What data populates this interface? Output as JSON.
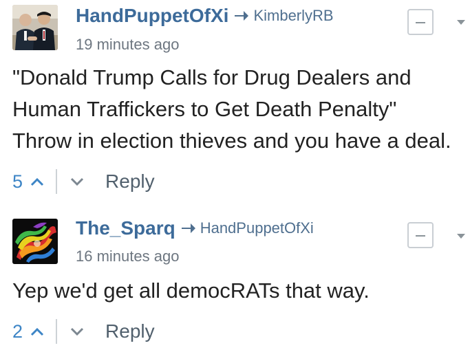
{
  "comments": [
    {
      "author": "HandPuppetOfXi",
      "reply_to": "KimberlyRB",
      "timestamp": "19 minutes ago",
      "body_lines": [
        "\"Donald Trump Calls for Drug Dealers and",
        "Human Traffickers to Get Death Penalty\"",
        "Throw in election thieves and you have a deal."
      ],
      "votes": "5",
      "reply_label": "Reply",
      "avatar_icon": "two-men-photo-avatar"
    },
    {
      "author": "The_Sparq",
      "reply_to": "HandPuppetOfXi",
      "timestamp": "16 minutes ago",
      "body_lines": [
        "Yep we'd get all democRATs that way."
      ],
      "votes": "2",
      "reply_label": "Reply",
      "avatar_icon": "rainbow-smoke-avatar"
    }
  ],
  "colors": {
    "author": "#3d6b9a",
    "vote": "#3d85c6",
    "text": "#222222",
    "meta": "#6d7680"
  }
}
